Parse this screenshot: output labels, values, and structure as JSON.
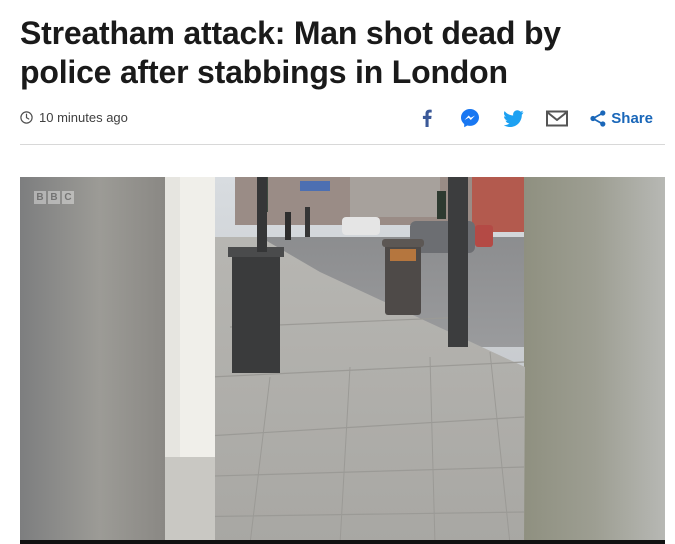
{
  "article": {
    "headline": "Streatham attack: Man shot dead by police after stabbings in London",
    "timestamp": "10 minutes ago"
  },
  "share_bar": {
    "icons": [
      "facebook-icon",
      "messenger-icon",
      "twitter-icon",
      "email-icon",
      "share-icon"
    ],
    "share_label": "Share"
  },
  "video": {
    "watermark": [
      "B",
      "B",
      "C"
    ]
  },
  "colors": {
    "headline": "#1a1a1a",
    "meta_text": "#404040",
    "facebook": "#3b5998",
    "messenger": "#1877f2",
    "twitter": "#1da1f2",
    "email": "#555555",
    "share": "#1a67b9",
    "divider": "#d8d8d8"
  }
}
